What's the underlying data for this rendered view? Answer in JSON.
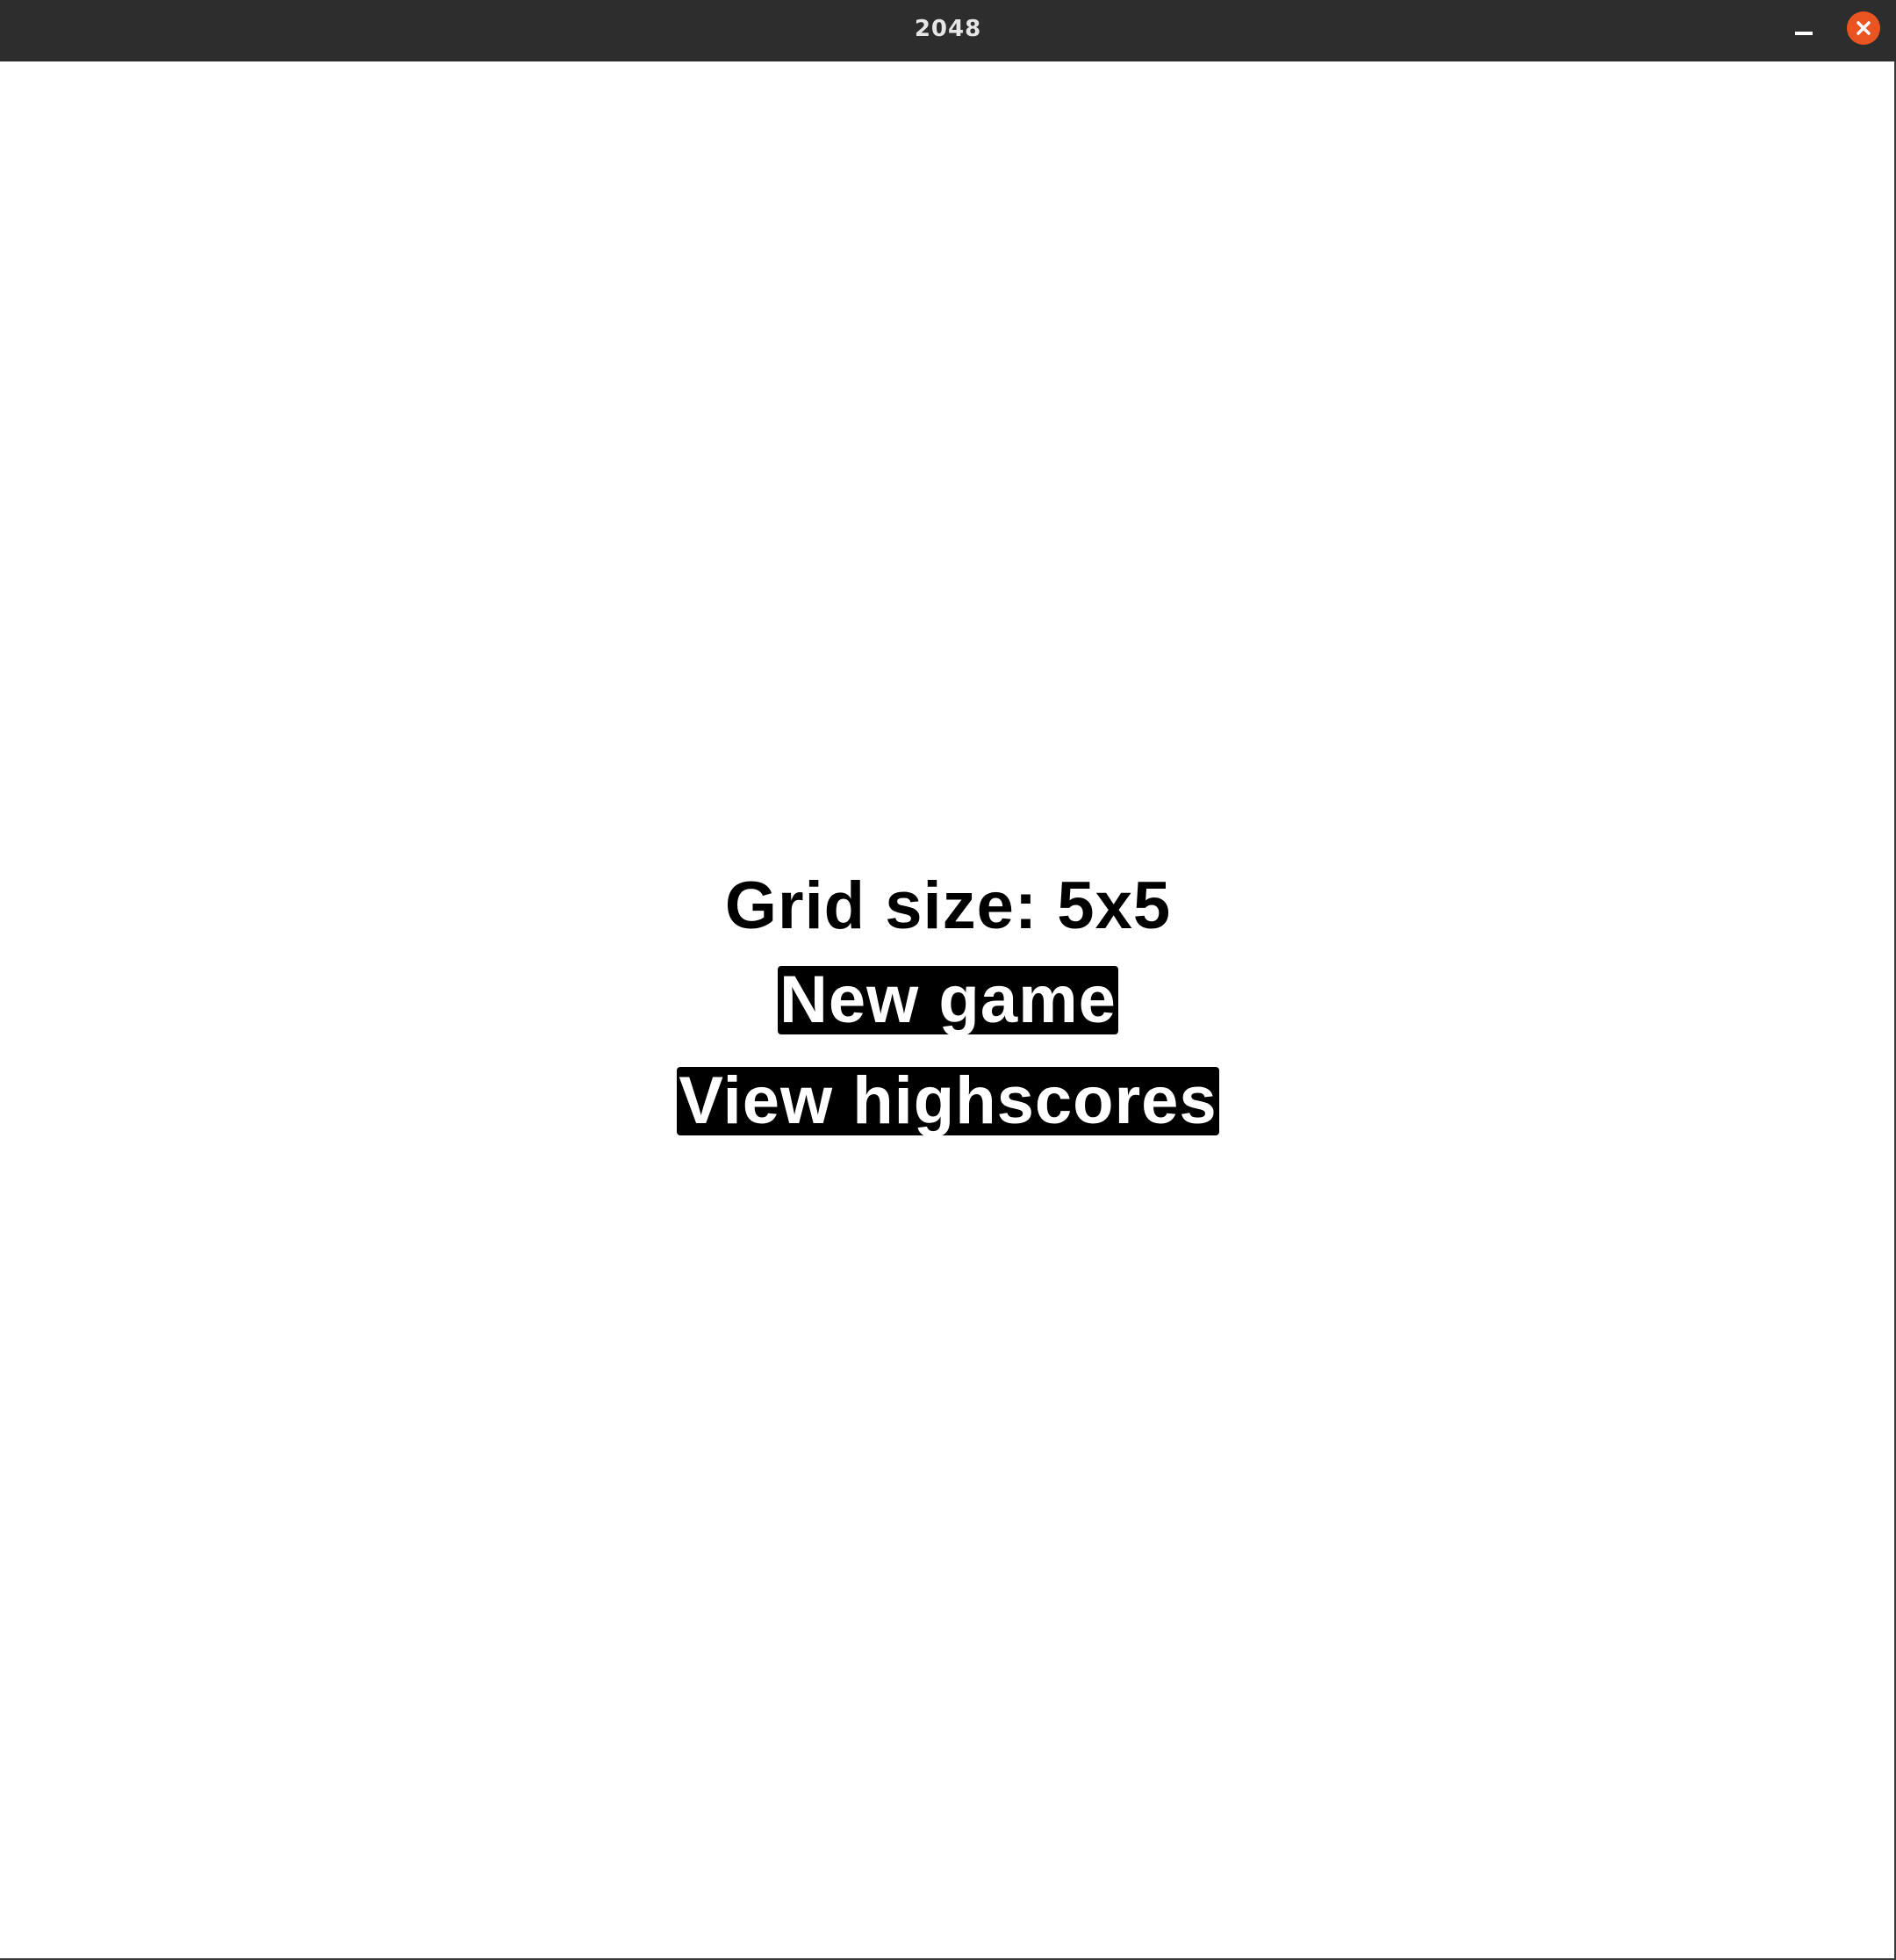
{
  "window": {
    "title": "2048",
    "controls": {
      "minimize_icon": "minimize-icon",
      "close_icon": "close-icon",
      "close_color": "#e95420"
    }
  },
  "menu": {
    "grid_size_label": "Grid size: 5x5",
    "new_game_label": "New game",
    "view_highscores_label": "View highscores"
  }
}
